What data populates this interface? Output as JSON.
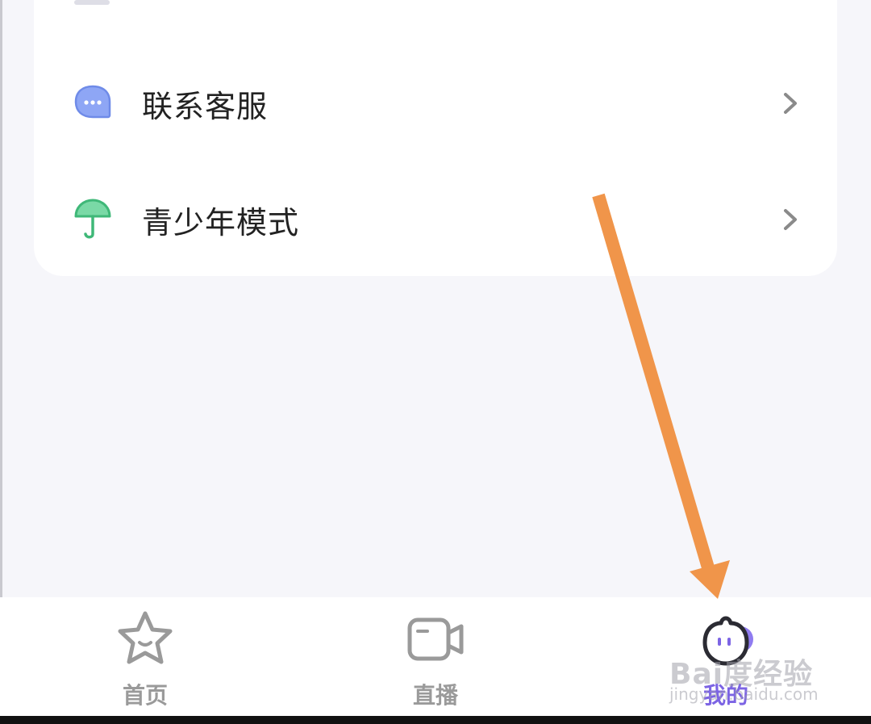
{
  "menu": {
    "items": [
      {
        "label": "联系客服",
        "icon": "chat-bubble-icon",
        "icon_color": "#7f9cf5"
      },
      {
        "label": "青少年模式",
        "icon": "umbrella-icon",
        "icon_color": "#4cc487"
      }
    ]
  },
  "tabbar": {
    "tabs": [
      {
        "label": "首页",
        "icon": "star-face-icon",
        "active": false
      },
      {
        "label": "直播",
        "icon": "video-camera-icon",
        "active": false
      },
      {
        "label": "我的",
        "icon": "profile-face-icon",
        "active": true
      }
    ],
    "active_color": "#7c64e4",
    "inactive_color": "#9a9a9a"
  },
  "annotation": {
    "type": "arrow",
    "color": "#f0954a"
  },
  "watermark": {
    "main": "Bai度经验",
    "sub": "jingyan.baidu.com"
  }
}
